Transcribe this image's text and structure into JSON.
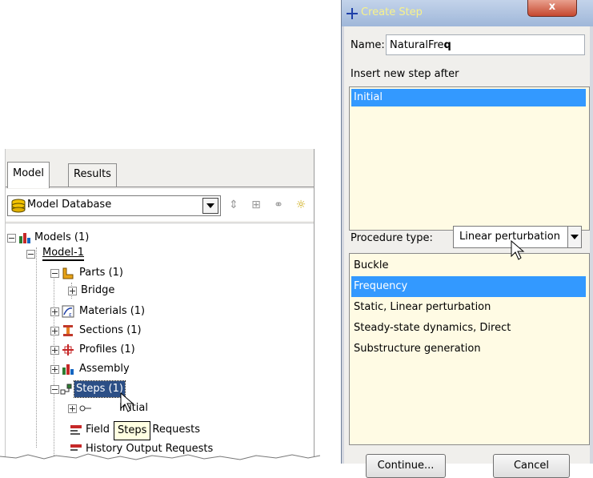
{
  "tree_panel": {
    "tabs": [
      {
        "label": "Model",
        "active": true
      },
      {
        "label": "Results",
        "active": false
      }
    ],
    "database_combo": {
      "value": "Model Database",
      "icon": "database-icon"
    },
    "toolbar_icons": [
      "sort-updown-icon",
      "expand-tree-icon",
      "filter-tree-icon",
      "hint-bulb-icon"
    ],
    "nodes": [
      {
        "label": "Models (1)",
        "icon": "models-icon"
      },
      {
        "label": "Model-1"
      },
      {
        "label": "Parts (1)",
        "icon": "parts-icon"
      },
      {
        "label": "Bridge"
      },
      {
        "label": "Materials (1)",
        "icon": "materials-icon"
      },
      {
        "label": "Sections (1)",
        "icon": "sections-icon"
      },
      {
        "label": "Profiles (1)",
        "icon": "profiles-icon"
      },
      {
        "label": "Assembly",
        "icon": "assembly-icon"
      },
      {
        "label": "Steps (1)",
        "icon": "steps-icon",
        "selected": true
      },
      {
        "label": "Initial",
        "icon": "initial-step-icon"
      },
      {
        "label": "Field Output Requests",
        "icon": "field-output-icon"
      },
      {
        "label": "History Output Requests",
        "icon": "history-output-icon"
      }
    ],
    "tooltip": "Steps"
  },
  "dialog": {
    "title": "Create Step",
    "name_label": "Name:",
    "name_value_plain": "NaturalFre",
    "name_value_bold": "q",
    "insert_label": "Insert new step after",
    "insert_after_items": [
      {
        "label": "Initial",
        "selected": true
      }
    ],
    "procedure_label": "Procedure type:",
    "procedure_value": "Linear perturbation",
    "procedures": [
      {
        "label": "Buckle",
        "selected": false
      },
      {
        "label": "Frequency",
        "selected": true
      },
      {
        "label": "Static, Linear perturbation",
        "selected": false
      },
      {
        "label": "Steady-state dynamics, Direct",
        "selected": false
      },
      {
        "label": "Substructure generation",
        "selected": false
      }
    ],
    "continue_label": "Continue...",
    "cancel_label": "Cancel",
    "close_label": "x"
  },
  "colors": {
    "selection": "#3399ff",
    "tree_selection": "#2c4f86",
    "list_background": "#fffbe4",
    "title_text": "#f8f28a"
  }
}
